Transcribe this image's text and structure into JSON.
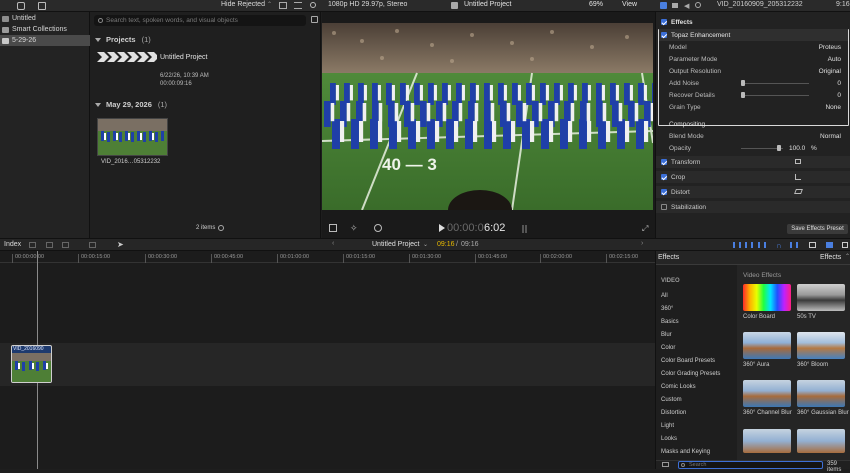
{
  "toolbar": {
    "filter_label": "Hide Rejected",
    "format_label": "1080p HD 29.97p, Stereo",
    "project_title": "Untitled Project",
    "zoom_label": "69%",
    "view_label": "View",
    "clip_name": "VID_20160909_205312232",
    "clip_duration": "9:16"
  },
  "sidebar": {
    "items": [
      {
        "label": "Untitled"
      },
      {
        "label": "Smart Collections"
      },
      {
        "label": "5-29-26"
      }
    ]
  },
  "browser": {
    "search_placeholder": "Search text, spoken words, and visual objects",
    "projects_heading": "Projects",
    "projects_count": "(1)",
    "project_name": "Untitled Project",
    "project_date": "6/22/26, 10:39 AM",
    "project_duration": "00:00:09:16",
    "date_heading": "May 29, 2026",
    "date_count": "(1)",
    "clip_name": "VID_2016…05312232",
    "items_label": "2 items"
  },
  "viewer": {
    "timecode_dim": "00:00:0",
    "timecode_bright": "6:02",
    "field_text": "40 — 3"
  },
  "inspector": {
    "section_effects": "Effects",
    "topaz_label": "Topaz Enhancement",
    "params": [
      {
        "label": "Model",
        "value": "Proteus"
      },
      {
        "label": "Parameter Mode",
        "value": "Auto"
      },
      {
        "label": "Output Resolution",
        "value": "Original"
      },
      {
        "label": "Add Noise",
        "value": "0"
      },
      {
        "label": "Recover Details",
        "value": "0"
      },
      {
        "label": "Grain Type",
        "value": "None"
      }
    ],
    "compositing_label": "Compositing",
    "blend_mode_label": "Blend Mode",
    "blend_mode_value": "Normal",
    "opacity_label": "Opacity",
    "opacity_value": "100.0",
    "opacity_unit": "%",
    "transform_label": "Transform",
    "crop_label": "Crop",
    "distort_label": "Distort",
    "stabilization_label": "Stabilization",
    "save_preset_label": "Save Effects Preset"
  },
  "timeline": {
    "index_label": "Index",
    "project_label": "Untitled Project",
    "time_current": "09:16",
    "time_sep": "/",
    "time_total": "09:16",
    "ruler": [
      "00:00:00:00",
      "00:00:15:00",
      "00:00:30:00",
      "00:00:45:00",
      "00:01:00:00",
      "00:01:15:00",
      "00:01:30:00",
      "00:01:45:00",
      "00:02:00:00",
      "00:02:15:00"
    ],
    "clip_label": "VID_2016090"
  },
  "effects_browser": {
    "header_left": "Effects",
    "header_right": "Effects",
    "group_label": "Video Effects",
    "categories": [
      "VIDEO",
      "All",
      "360°",
      "Basics",
      "Blur",
      "Color",
      "Color Board Presets",
      "Color Grading Presets",
      "Comic Looks",
      "Custom",
      "Distortion",
      "Light",
      "Looks",
      "Masks and Keying"
    ],
    "effects": [
      {
        "name": "Color Board"
      },
      {
        "name": "50s TV"
      },
      {
        "name": "360° Aura"
      },
      {
        "name": "360° Bloom"
      },
      {
        "name": "360° Channel Blur"
      },
      {
        "name": "360° Gaussian Blur"
      }
    ],
    "search_placeholder": "Search",
    "count_label": "359 items"
  }
}
